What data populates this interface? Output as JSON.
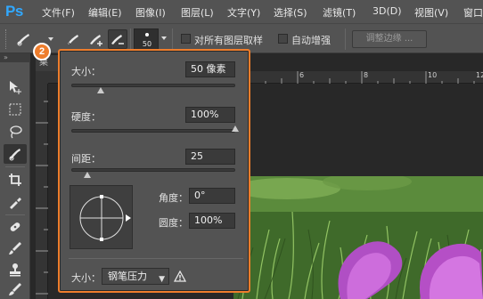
{
  "app": {
    "logo": "Ps"
  },
  "menu": [
    "文件(F)",
    "编辑(E)",
    "图像(I)",
    "图层(L)",
    "文字(Y)",
    "选择(S)",
    "滤镜(T)",
    "3D(D)",
    "视图(V)",
    "窗口"
  ],
  "options": {
    "brush_size": "50",
    "sample_all_layers": "对所有图层取样",
    "auto_enhance": "自动增强",
    "refine_edge": "调整边缘 ..."
  },
  "toolbar_head": "»",
  "document": {
    "tab": "桌",
    "ruler_h": [
      "6",
      "8",
      "10",
      "12"
    ]
  },
  "badge": "2",
  "panel": {
    "size_label": "大小：",
    "size_value": "50 像素",
    "hardness_label": "硬度：",
    "hardness_value": "100%",
    "spacing_label": "间距：",
    "spacing_value": "25",
    "angle_label": "角度：",
    "angle_value": "0°",
    "roundness_label": "圆度：",
    "roundness_value": "100%",
    "size_control_label": "大小：",
    "size_control_value": "钢笔压力",
    "sliders": {
      "size": 0.18,
      "hardness": 1.0,
      "spacing": 0.1
    }
  },
  "colors": {
    "accent": "#ee7d2c",
    "ps_blue": "#31a8ff",
    "ui_bg": "#535353"
  }
}
